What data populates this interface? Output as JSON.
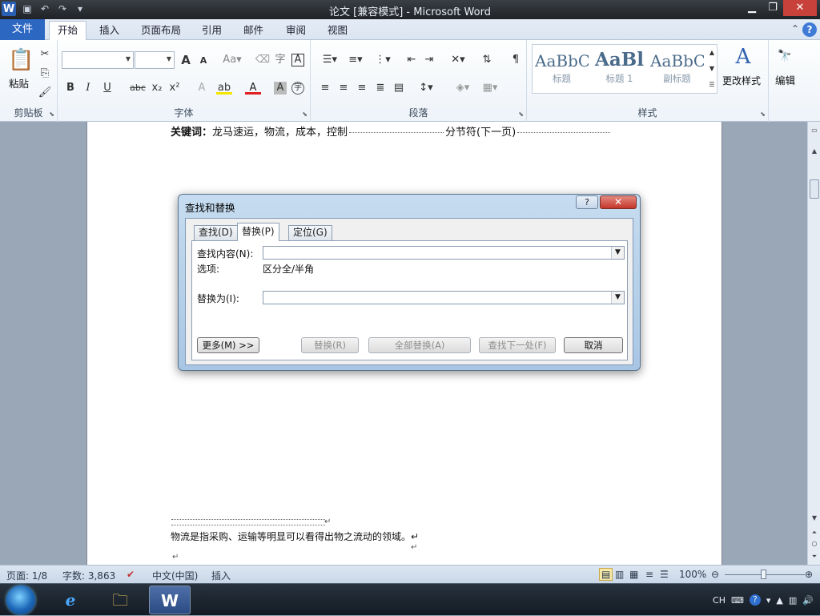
{
  "window": {
    "title": "论文 [兼容模式] - Microsoft Word",
    "minimize_glyph": "▁",
    "maximize_glyph": "❐",
    "close_glyph": "✕"
  },
  "ribbon_tabs": {
    "file": "文件",
    "home": "开始",
    "insert": "插入",
    "layout": "页面布局",
    "references": "引用",
    "mailings": "邮件",
    "review": "审阅",
    "view": "视图"
  },
  "ribbon": {
    "clipboard": {
      "label": "剪贴板",
      "paste": "粘贴"
    },
    "font": {
      "label": "字体",
      "bold": "B",
      "italic": "I",
      "underline": "U",
      "strike": "abc",
      "sub": "x₂",
      "sup": "x²",
      "grow": "A",
      "shrink": "A"
    },
    "paragraph": {
      "label": "段落"
    },
    "styles": {
      "label": "样式",
      "items": [
        {
          "sample": "AaBbC",
          "name": "标题"
        },
        {
          "sample": "AaBl",
          "name": "标题 1"
        },
        {
          "sample": "AaBbC",
          "name": "副标题"
        }
      ],
      "change_styles": "更改样式"
    },
    "editing": {
      "label": "编辑"
    }
  },
  "document": {
    "keywords_label": "关键词：",
    "keywords_text": "龙马速运，物流，成本，控制",
    "section_break": "分节符(下一页)",
    "footnote_text": "物流是指采购、运输等明显可以看得出物之流动的领域。",
    "para_mark": "↵"
  },
  "dialog": {
    "title": "查找和替换",
    "help": "?",
    "close": "✕",
    "tabs": {
      "find": "查找(D)",
      "replace": "替换(P)",
      "goto": "定位(G)"
    },
    "find_label": "查找内容(N):",
    "find_value": "",
    "options_label": "选项:",
    "options_value": "区分全/半角",
    "replace_label": "替换为(I):",
    "replace_value": "",
    "buttons": {
      "more": "更多(M) >>",
      "replace": "替换(R)",
      "replace_all": "全部替换(A)",
      "find_next": "查找下一处(F)",
      "cancel": "取消"
    }
  },
  "status": {
    "page": "页面: 1/8",
    "words": "字数: 3,863",
    "language": "中文(中国)",
    "insert_mode": "插入",
    "zoom": "100%"
  },
  "taskbar": {
    "ime": "CH"
  }
}
